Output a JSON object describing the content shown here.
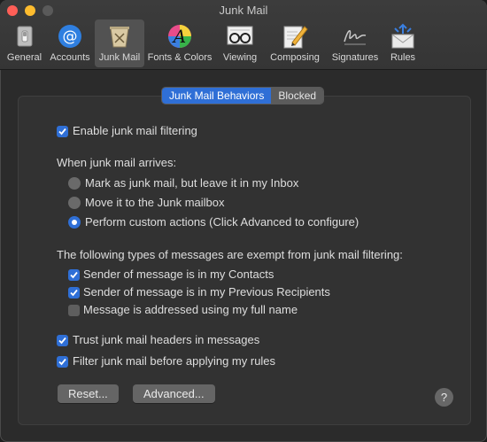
{
  "window": {
    "title": "Junk Mail",
    "toolbar": [
      {
        "label": "General",
        "icon": "general-icon"
      },
      {
        "label": "Accounts",
        "icon": "at-sign-icon"
      },
      {
        "label": "Junk Mail",
        "icon": "trash-icon",
        "selected": true
      },
      {
        "label": "Fonts & Colors",
        "icon": "font-color-icon"
      },
      {
        "label": "Viewing",
        "icon": "glasses-icon"
      },
      {
        "label": "Composing",
        "icon": "pencil-icon"
      },
      {
        "label": "Signatures",
        "icon": "signature-icon"
      },
      {
        "label": "Rules",
        "icon": "rules-envelope-icon"
      }
    ]
  },
  "tabs": {
    "behaviors": "Junk Mail Behaviors",
    "blocked": "Blocked",
    "active": "Junk Mail Behaviors"
  },
  "settings": {
    "enable_filtering": {
      "label": "Enable junk mail filtering",
      "checked": true
    },
    "arrival_heading": "When junk mail arrives:",
    "arrival_options": [
      {
        "label": "Mark as junk mail, but leave it in my Inbox",
        "selected": false
      },
      {
        "label": "Move it to the Junk mailbox",
        "selected": false
      },
      {
        "label": "Perform custom actions (Click Advanced to configure)",
        "selected": true
      }
    ],
    "exempt_heading": "The following types of messages are exempt from junk mail filtering:",
    "exempt_options": [
      {
        "label": "Sender of message is in my Contacts",
        "checked": true
      },
      {
        "label": "Sender of message is in my Previous Recipients",
        "checked": true
      },
      {
        "label": "Message is addressed using my full name",
        "checked": false
      }
    ],
    "trust_headers": {
      "label": "Trust junk mail headers in messages",
      "checked": true
    },
    "filter_before_rules": {
      "label": "Filter junk mail before applying my rules",
      "checked": true
    }
  },
  "buttons": {
    "reset": "Reset...",
    "advanced": "Advanced...",
    "help": "?"
  },
  "colors": {
    "accent": "#2f6fd6",
    "background": "#2b2b2b",
    "panel": "#323232"
  }
}
